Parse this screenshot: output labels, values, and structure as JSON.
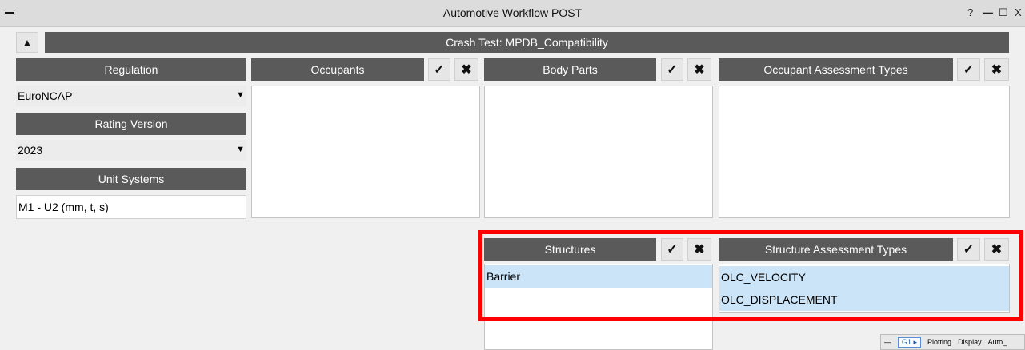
{
  "window": {
    "title": "Automotive Workflow POST",
    "help": "?",
    "minimize": "—",
    "maximize": "☐",
    "close": "X"
  },
  "header": {
    "collapse_glyph": "▲",
    "banner": "Crash Test: MPDB_Compatibility"
  },
  "left": {
    "regulation_label": "Regulation",
    "regulation_value": "EuroNCAP",
    "rating_label": "Rating Version",
    "rating_value": "2023",
    "units_label": "Unit Systems",
    "units_value": "M1 - U2 (mm, t, s)"
  },
  "columns": {
    "occupants": "Occupants",
    "body_parts": "Body Parts",
    "occ_assess": "Occupant Assessment Types",
    "structures": "Structures",
    "struct_assess": "Structure Assessment Types"
  },
  "icons": {
    "check": "✓",
    "x": "✖",
    "caret": "▼"
  },
  "structures": {
    "items": [
      "Barrier"
    ]
  },
  "structure_assessment": {
    "items": [
      "OLC_VELOCITY",
      "OLC_DISPLACEMENT"
    ]
  },
  "mini_window": {
    "tab": "G1 ▸",
    "plotting": "Plotting",
    "display": "Display",
    "auto": "Auto_"
  },
  "colors": {
    "header_bg": "#5a5a5a",
    "selection_bg": "#cce4f7",
    "highlight_border": "#ff0000"
  }
}
